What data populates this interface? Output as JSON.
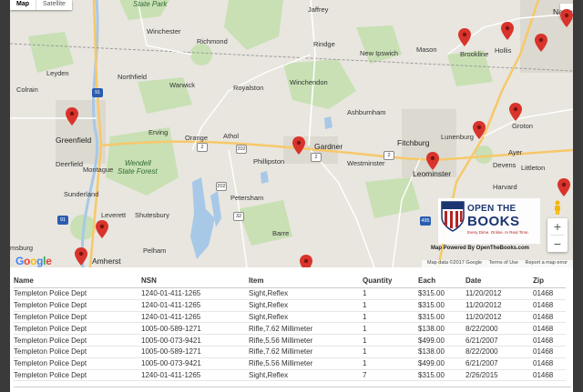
{
  "map": {
    "type_buttons": [
      "Map",
      "Satellite"
    ],
    "labels": {
      "state_park": "State Park",
      "winchester": "Winchester",
      "richmond": "Richmond",
      "jaffrey": "Jaffrey",
      "rindge": "Rindge",
      "new_ipswich": "New Ipswich",
      "mason": "Mason",
      "hollis": "Hollis",
      "nashua": "Nashua",
      "brookline": "Brookline",
      "leyden": "Leyden",
      "northfield": "Northfield",
      "warwick": "Warwick",
      "royalston": "Royalston",
      "winchendon": "Winchendon",
      "colrain": "Colrain",
      "ashburnham": "Ashburnham",
      "greenfield": "Greenfield",
      "erving": "Erving",
      "orange": "Orange",
      "athol": "Athol",
      "gardner": "Gardner",
      "fitchburg": "Fitchburg",
      "lunenburg": "Lunenburg",
      "groton": "Groton",
      "ayer": "Ayer",
      "devens": "Devens",
      "deerfield": "Deerfield",
      "montague": "Montague",
      "wendell_park_1": "Wendell",
      "wendell_park_2": "State Forest",
      "phillipston": "Phillipston",
      "westminster": "Westminster",
      "leominster": "Leominster",
      "littleton": "Littleton",
      "harvard": "Harvard",
      "sunderland": "Sunderland",
      "leverett": "Leverett",
      "shutesbury": "Shutesbury",
      "petersham": "Petersham",
      "barre": "Barre",
      "amherst": "Amherst",
      "pelham": "Pelham",
      "burg": "msburg"
    },
    "shields": [
      "91",
      "2",
      "202",
      "2",
      "2",
      "32",
      "495",
      "91",
      "202"
    ],
    "google_logo": [
      "G",
      "o",
      "o",
      "g",
      "l",
      "e"
    ],
    "attribution": [
      "Map data ©2017 Google",
      "Terms of Use",
      "Report a map error"
    ],
    "powered_by": "Map Powered By OpenTheBooks.com",
    "logo": {
      "line1": "OPEN THE",
      "line2": "BOOKS",
      "tagline": "Every Dime. Online. In Real Time."
    },
    "zoom_in": "+",
    "zoom_out": "−",
    "colors": {
      "pin": "#d8342c",
      "park": "#c8e0b4",
      "water": "#a8c8e8",
      "highway": "#f7c86a",
      "land": "#e8e6df",
      "urban": "#dcd9d0"
    }
  },
  "table": {
    "headers": [
      "Name",
      "NSN",
      "Item",
      "Quantity",
      "Each",
      "Date",
      "Zip"
    ],
    "rows": [
      [
        "Templeton Police Dept",
        "1240-01-411-1265",
        "Sight,Reflex",
        "1",
        "$315.00",
        "11/20/2012",
        "01468"
      ],
      [
        "Templeton Police Dept",
        "1240-01-411-1265",
        "Sight,Reflex",
        "1",
        "$315.00",
        "11/20/2012",
        "01468"
      ],
      [
        "Templeton Police Dept",
        "1240-01-411-1265",
        "Sight,Reflex",
        "1",
        "$315.00",
        "11/20/2012",
        "01468"
      ],
      [
        "Templeton Police Dept",
        "1005-00-589-1271",
        "Rifle,7.62 Millimeter",
        "1",
        "$138.00",
        "8/22/2000",
        "01468"
      ],
      [
        "Templeton Police Dept",
        "1005-00-073-9421",
        "Rifle,5.56 Millimeter",
        "1",
        "$499.00",
        "6/21/2007",
        "01468"
      ],
      [
        "Templeton Police Dept",
        "1005-00-589-1271",
        "Rifle,7.62 Millimeter",
        "1",
        "$138.00",
        "8/22/2000",
        "01468"
      ],
      [
        "Templeton Police Dept",
        "1005-00-073-9421",
        "Rifle,5.56 Millimeter",
        "1",
        "$499.00",
        "6/21/2007",
        "01468"
      ],
      [
        "Templeton Police Dept",
        "1240-01-411-1265",
        "Sight,Reflex",
        "7",
        "$315.00",
        "2/26/2015",
        "01468"
      ]
    ]
  }
}
